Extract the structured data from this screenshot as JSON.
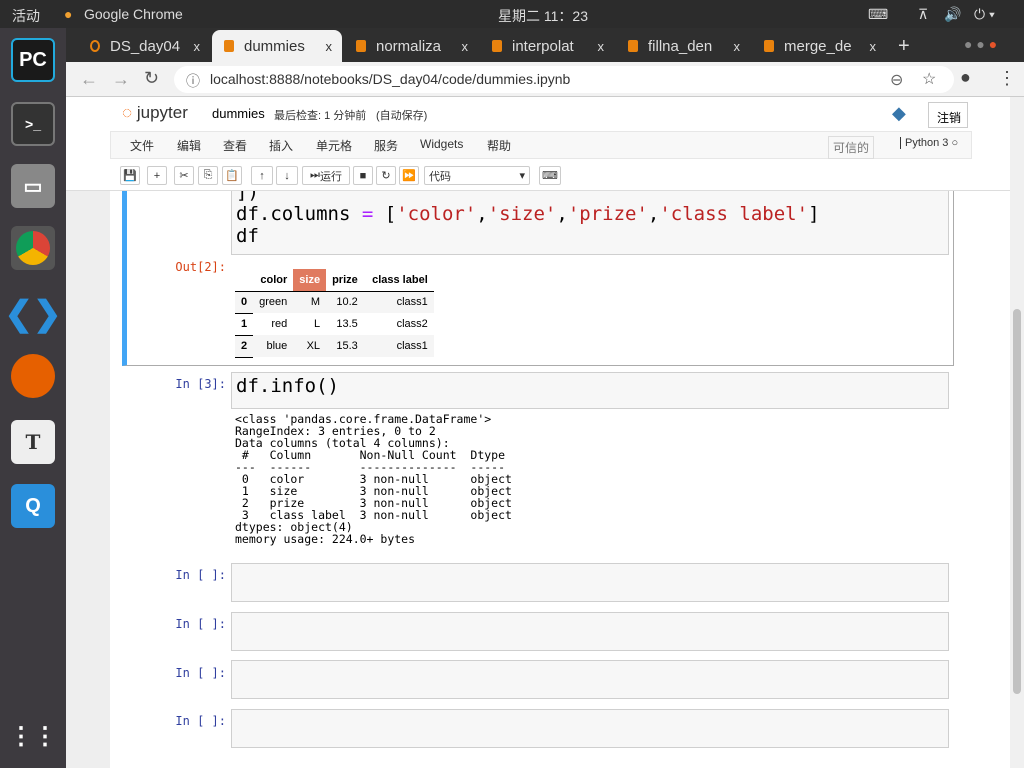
{
  "system": {
    "activities": "活动",
    "app": "Google Chrome",
    "clock": "星期二 11：23"
  },
  "tabs": [
    {
      "label": "DS_day04"
    },
    {
      "label": "dummies",
      "active": true
    },
    {
      "label": "normaliza"
    },
    {
      "label": "interpolat"
    },
    {
      "label": "fillna_den"
    },
    {
      "label": "merge_de"
    }
  ],
  "tab_close": "x",
  "new_tab": "+",
  "address": {
    "url": "localhost:8888/notebooks/DS_day04/code/dummies.ipynb"
  },
  "jupyter": {
    "logo": "jupyter",
    "notebook_name": "dummies",
    "checkpoint": "最后检查: 1 分钟前",
    "autosave": "(自动保存)",
    "logout": "注销",
    "menu": [
      "文件",
      "编辑",
      "查看",
      "插入",
      "单元格",
      "服务",
      "Widgets",
      "帮助"
    ],
    "trusted": "可信的",
    "kernel": "Python 3",
    "toolbar": {
      "run": "运行",
      "cell_type": "代码"
    }
  },
  "cells": [
    {
      "code_lines": [
        "            ])",
        "df.columns = ['color','size','prize','class label']",
        "df"
      ],
      "out_prompt": "Out[2]:",
      "table": {
        "columns": [
          "",
          "color",
          "size",
          "prize",
          "class label"
        ],
        "rows": [
          [
            "0",
            "green",
            "M",
            "10.2",
            "class1"
          ],
          [
            "1",
            "red",
            "L",
            "13.5",
            "class2"
          ],
          [
            "2",
            "blue",
            "XL",
            "15.3",
            "class1"
          ]
        ]
      }
    },
    {
      "prompt": "In [3]:",
      "code": "df.info()",
      "output": "<class 'pandas.core.frame.DataFrame'>\nRangeIndex: 3 entries, 0 to 2\nData columns (total 4 columns):\n #   Column       Non-Null Count  Dtype \n---  ------       --------------  ----- \n 0   color        3 non-null      object\n 1   size         3 non-null      object\n 2   prize        3 non-null      object\n 3   class label  3 non-null      object\ndtypes: object(4)\nmemory usage: 224.0+ bytes"
    },
    {
      "prompt": "In [ ]:"
    },
    {
      "prompt": "In [ ]:"
    },
    {
      "prompt": "In [ ]:"
    },
    {
      "prompt": "In [ ]:"
    }
  ]
}
